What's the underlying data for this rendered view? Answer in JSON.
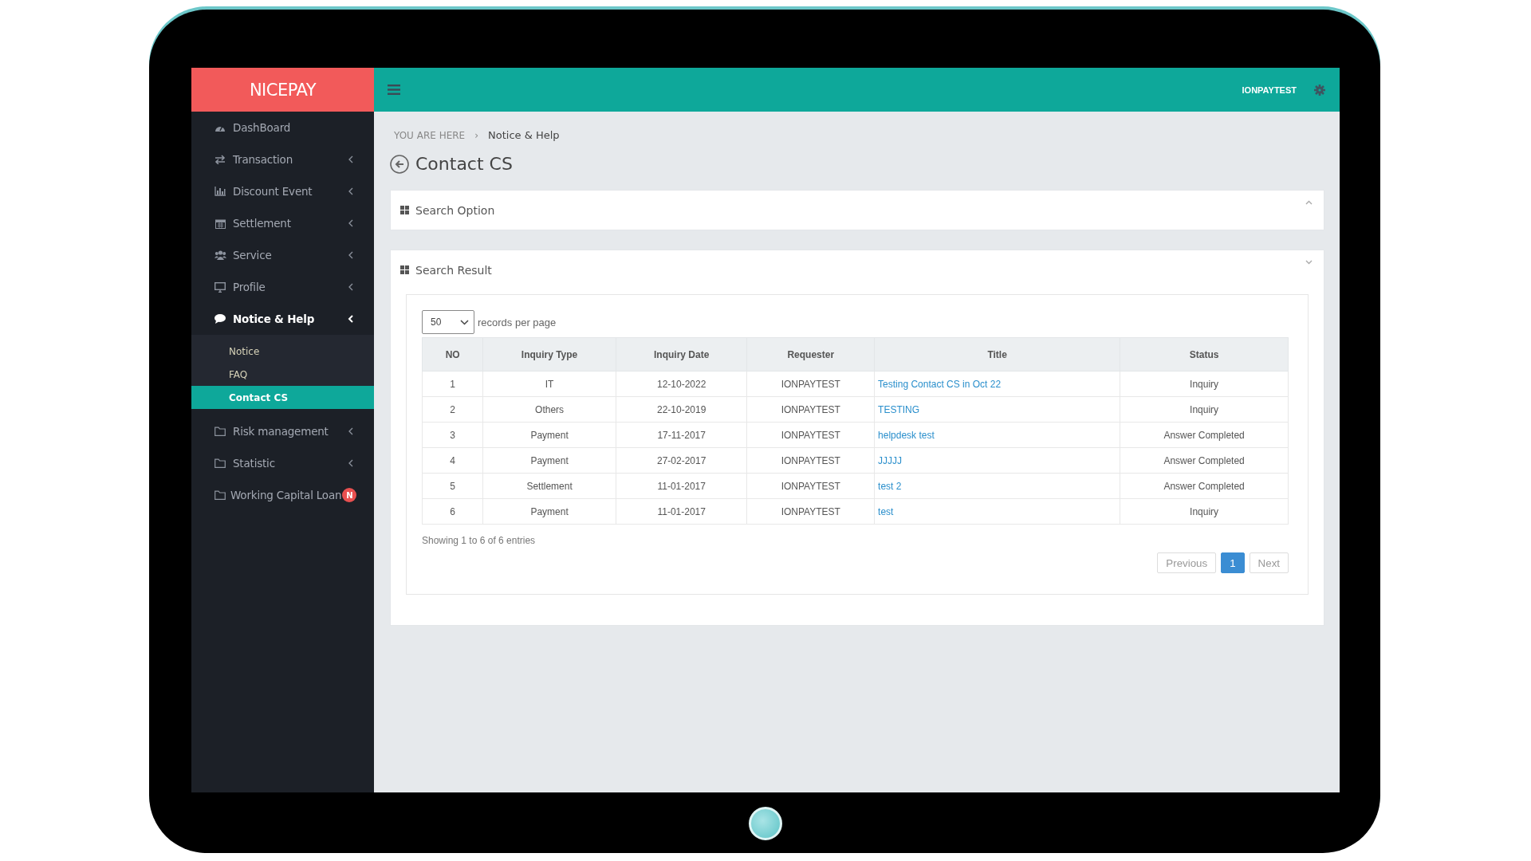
{
  "sidebar": {
    "logo": "NICEPAY",
    "items": [
      {
        "label": "DashBoard",
        "selected": false,
        "expandable": false
      },
      {
        "label": "Transaction",
        "selected": false,
        "expandable": true
      },
      {
        "label": "Discount Event",
        "selected": false,
        "expandable": true
      },
      {
        "label": "Settlement",
        "selected": false,
        "expandable": true
      },
      {
        "label": "Service",
        "selected": false,
        "expandable": true
      },
      {
        "label": "Profile",
        "selected": false,
        "expandable": true
      },
      {
        "label": "Notice & Help",
        "selected": true,
        "expandable": true,
        "children": [
          {
            "label": "Notice",
            "selected": false
          },
          {
            "label": "FAQ",
            "selected": false
          },
          {
            "label": "Contact CS",
            "selected": true
          }
        ]
      },
      {
        "label": "Risk management",
        "selected": false,
        "expandable": true
      },
      {
        "label": "Statistic",
        "selected": false,
        "expandable": true
      },
      {
        "label": "Working Capital Loan",
        "selected": false,
        "expandable": false,
        "badge": "N"
      }
    ]
  },
  "topbar": {
    "user": "IONPAYTEST"
  },
  "breadcrumb": {
    "prefix": "YOU ARE HERE",
    "separator": "›",
    "current": "Notice & Help"
  },
  "page_title": "Contact CS",
  "search_option": {
    "title": "Search Option",
    "expanded": false
  },
  "search_result": {
    "title": "Search Result",
    "expanded": true,
    "page_size": "50",
    "page_size_label": "records per page",
    "table": {
      "columns": [
        {
          "label": "NO",
          "kind": "text"
        },
        {
          "label": "Inquiry Type",
          "kind": "text"
        },
        {
          "label": "Inquiry Date",
          "kind": "text"
        },
        {
          "label": "Requester",
          "kind": "text"
        },
        {
          "label": "Title",
          "kind": "link"
        },
        {
          "label": "Status",
          "kind": "text"
        }
      ],
      "rows": [
        [
          "1",
          "IT",
          "12-10-2022",
          "IONPAYTEST",
          "Testing Contact CS in Oct 22",
          "Inquiry"
        ],
        [
          "2",
          "Others",
          "22-10-2019",
          "IONPAYTEST",
          "TESTING",
          "Inquiry"
        ],
        [
          "3",
          "Payment",
          "17-11-2017",
          "IONPAYTEST",
          "helpdesk test",
          "Answer Completed"
        ],
        [
          "4",
          "Payment",
          "27-02-2017",
          "IONPAYTEST",
          "JJJJJ",
          "Answer Completed"
        ],
        [
          "5",
          "Settlement",
          "11-01-2017",
          "IONPAYTEST",
          "test 2",
          "Answer Completed"
        ],
        [
          "6",
          "Payment",
          "11-01-2017",
          "IONPAYTEST",
          "test",
          "Inquiry"
        ]
      ]
    },
    "info": "Showing 1 to 6 of 6 entries",
    "pagination": {
      "previous": {
        "label": "Previous",
        "disabled": true
      },
      "pages": [
        {
          "label": "1",
          "selected": true
        }
      ],
      "next": {
        "label": "Next",
        "disabled": true
      }
    }
  }
}
